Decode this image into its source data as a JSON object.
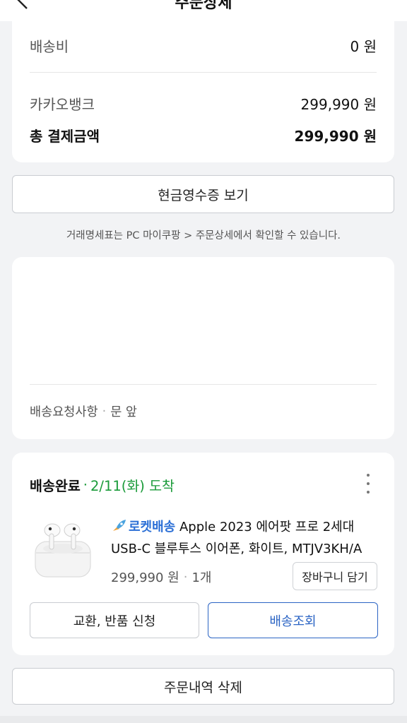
{
  "header": {
    "title": "주문상세",
    "back_icon": "chevron-left-icon"
  },
  "payment": {
    "shipping_label": "배송비",
    "shipping_value": "0 원",
    "method_label": "카카오뱅크",
    "method_value": "299,990 원",
    "total_label": "총 결제금액",
    "total_value": "299,990 원"
  },
  "receipt_button": "현금영수증 보기",
  "notice": "거래명세표는 PC 마이쿠팡 > 주문상세에서 확인할 수 있습니다.",
  "delivery_request": {
    "label": "배송요청사항",
    "separator": "·",
    "value": "문 앞"
  },
  "shipment": {
    "status": "배송완료",
    "separator": "·",
    "arrival": "2/11(화) 도착",
    "product": {
      "badge": "로켓배송",
      "title": "Apple 2023 에어팟 프로 2세대 USB-C 블루투스 이어폰, 화이트, MTJV3KH/A",
      "price": "299,990 원",
      "quantity": "1개"
    },
    "cart_button": "장바구니 담기",
    "return_button": "교환, 반품 신청",
    "track_button": "배송조회"
  },
  "delete_button": "주문내역 삭제",
  "colors": {
    "accent_blue": "#2b64c4",
    "status_green": "#1b9b3a",
    "rocket_blue": "#2b6fd6"
  }
}
